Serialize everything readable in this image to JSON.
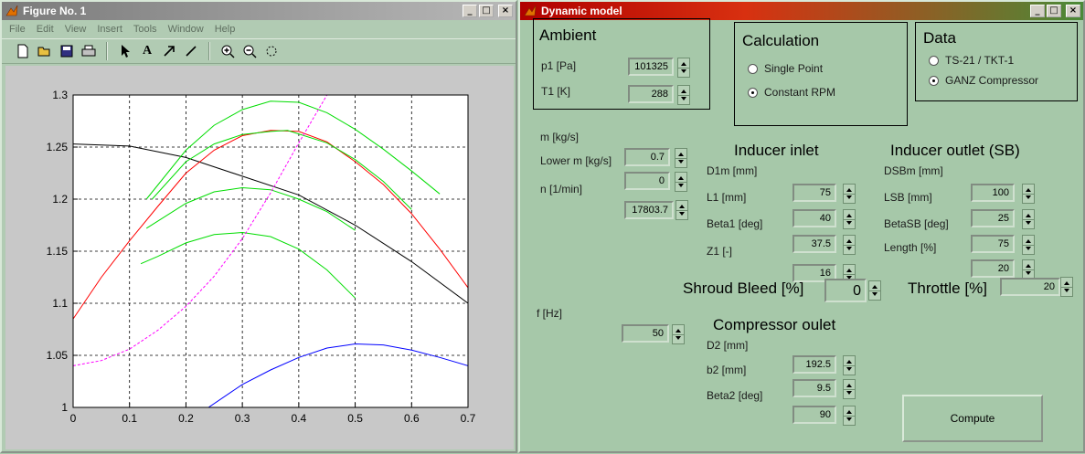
{
  "figure_window": {
    "title": "Figure No. 1",
    "menu": [
      "File",
      "Edit",
      "View",
      "Insert",
      "Tools",
      "Window",
      "Help"
    ]
  },
  "chart_data": {
    "type": "line",
    "title": "",
    "xlabel": "",
    "ylabel": "",
    "xlim": [
      0,
      0.7
    ],
    "ylim": [
      1,
      1.3
    ],
    "xticks": [
      "0",
      "0.1",
      "0.2",
      "0.3",
      "0.4",
      "0.5",
      "0.6",
      "0.7"
    ],
    "yticks": [
      "1",
      "1.05",
      "1.1",
      "1.15",
      "1.2",
      "1.25",
      "1.3"
    ],
    "grid": true,
    "series": [
      {
        "color": "#000000",
        "x": [
          0,
          0.1,
          0.2,
          0.3,
          0.4,
          0.5,
          0.6,
          0.7
        ],
        "y": [
          1.253,
          1.251,
          1.24,
          1.222,
          1.204,
          1.175,
          1.14,
          1.1
        ]
      },
      {
        "color": "#ff0000",
        "x": [
          0,
          0.05,
          0.1,
          0.15,
          0.2,
          0.25,
          0.3,
          0.35,
          0.4,
          0.45,
          0.5,
          0.55,
          0.6,
          0.65,
          0.7
        ],
        "y": [
          1.085,
          1.125,
          1.16,
          1.193,
          1.225,
          1.247,
          1.261,
          1.266,
          1.265,
          1.255,
          1.236,
          1.214,
          1.186,
          1.152,
          1.115
        ]
      },
      {
        "color": "#00dd00",
        "x": [
          0.13,
          0.2,
          0.25,
          0.3,
          0.35,
          0.4,
          0.45,
          0.5,
          0.55,
          0.6,
          0.65
        ],
        "y": [
          1.2,
          1.247,
          1.271,
          1.286,
          1.294,
          1.293,
          1.283,
          1.267,
          1.248,
          1.227,
          1.205
        ]
      },
      {
        "color": "#00dd00",
        "x": [
          0.14,
          0.2,
          0.25,
          0.3,
          0.35,
          0.38,
          0.45,
          0.5,
          0.55,
          0.6
        ],
        "y": [
          1.2,
          1.236,
          1.253,
          1.262,
          1.265,
          1.266,
          1.254,
          1.238,
          1.217,
          1.19
        ]
      },
      {
        "color": "#00dd00",
        "x": [
          0.13,
          0.2,
          0.25,
          0.3,
          0.35,
          0.4,
          0.45,
          0.5
        ],
        "y": [
          1.172,
          1.196,
          1.207,
          1.211,
          1.209,
          1.2,
          1.188,
          1.17
        ]
      },
      {
        "color": "#00dd00",
        "x": [
          0.12,
          0.15,
          0.2,
          0.25,
          0.3,
          0.35,
          0.4,
          0.45,
          0.5
        ],
        "y": [
          1.138,
          1.145,
          1.158,
          1.166,
          1.168,
          1.164,
          1.152,
          1.132,
          1.105
        ]
      },
      {
        "color": "#ff00ff",
        "dashed": true,
        "x": [
          0,
          0.05,
          0.1,
          0.15,
          0.2,
          0.25,
          0.3,
          0.35,
          0.4,
          0.45
        ],
        "y": [
          1.04,
          1.045,
          1.056,
          1.074,
          1.097,
          1.126,
          1.162,
          1.206,
          1.254,
          1.3
        ]
      },
      {
        "color": "#0000ff",
        "x": [
          0.24,
          0.3,
          0.35,
          0.4,
          0.45,
          0.5,
          0.55,
          0.6,
          0.65,
          0.7
        ],
        "y": [
          1.0,
          1.022,
          1.036,
          1.048,
          1.057,
          1.061,
          1.06,
          1.055,
          1.048,
          1.04
        ]
      }
    ]
  },
  "dynamic_window": {
    "title": "Dynamic model",
    "ambient": {
      "header": "Ambient",
      "p1_label": "p1 [Pa]",
      "p1_value": "101325",
      "t1_label": "T1 [K]",
      "t1_value": "288"
    },
    "calculation": {
      "header": "Calculation",
      "options": [
        "Single Point",
        "Constant RPM"
      ],
      "selected": "Constant RPM"
    },
    "data": {
      "header": "Data",
      "options": [
        "TS-21 / TKT-1",
        "GANZ Compressor"
      ],
      "selected": "GANZ Compressor"
    },
    "flow": {
      "m_label": "m [kg/s]",
      "m_value": "0.7",
      "lower_label": "Lower m [kg/s]",
      "lower_value": "0",
      "n_label": "n [1/min]",
      "n_value": "17803.7"
    },
    "inducer_inlet": {
      "header": "Inducer inlet",
      "fields": [
        {
          "label": "D1m [mm]",
          "value": "75"
        },
        {
          "label": "L1 [mm]",
          "value": "40"
        },
        {
          "label": "Beta1 [deg]",
          "value": "37.5"
        },
        {
          "label": "Z1 [-]",
          "value": "16"
        }
      ]
    },
    "inducer_outlet": {
      "header": "Inducer outlet (SB)",
      "fields": [
        {
          "label": "DSBm [mm]",
          "value": "100"
        },
        {
          "label": "LSB [mm]",
          "value": "25"
        },
        {
          "label": "BetaSB [deg]",
          "value": "75"
        },
        {
          "label": "Length [%]",
          "value": "20"
        }
      ]
    },
    "shroud_bleed": {
      "label": "Shroud Bleed [%]",
      "value": "0"
    },
    "throttle": {
      "label": "Throttle [%]",
      "value": "20"
    },
    "freq": {
      "label": "f [Hz]",
      "value": "50"
    },
    "outlet": {
      "header": "Compressor oulet",
      "fields": [
        {
          "label": "D2 [mm]",
          "value": "192.5"
        },
        {
          "label": "b2 [mm]",
          "value": "9.5"
        },
        {
          "label": "Beta2 [deg]",
          "value": "90"
        }
      ]
    },
    "compute_label": "Compute"
  }
}
